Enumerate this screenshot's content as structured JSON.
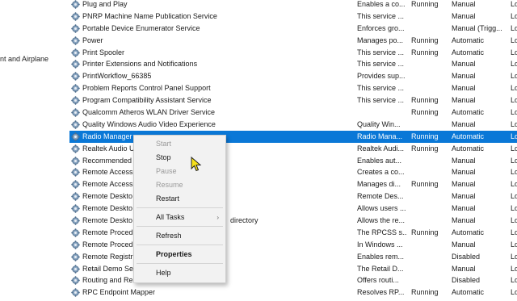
{
  "left_text": "nt and Airplane",
  "services": [
    {
      "name": "Plug and Play",
      "desc": "Enables a co...",
      "status": "Running",
      "startup": "Manual",
      "logon": "Lo"
    },
    {
      "name": "PNRP Machine Name Publication Service",
      "desc": "This service ...",
      "status": "",
      "startup": "Manual",
      "logon": "Lo"
    },
    {
      "name": "Portable Device Enumerator Service",
      "desc": "Enforces gro...",
      "status": "",
      "startup": "Manual (Trigg...",
      "logon": "Lo"
    },
    {
      "name": "Power",
      "desc": "Manages po...",
      "status": "Running",
      "startup": "Automatic",
      "logon": "Lo"
    },
    {
      "name": "Print Spooler",
      "desc": "This service ...",
      "status": "Running",
      "startup": "Automatic",
      "logon": "Lo"
    },
    {
      "name": "Printer Extensions and Notifications",
      "desc": "This service ...",
      "status": "",
      "startup": "Manual",
      "logon": "Lo"
    },
    {
      "name": "PrintWorkflow_66385",
      "desc": "Provides sup...",
      "status": "",
      "startup": "Manual",
      "logon": "Lo"
    },
    {
      "name": "Problem Reports Control Panel Support",
      "desc": "This service ...",
      "status": "",
      "startup": "Manual",
      "logon": "Lo"
    },
    {
      "name": "Program Compatibility Assistant Service",
      "desc": "This service ...",
      "status": "Running",
      "startup": "Manual",
      "logon": "Lo"
    },
    {
      "name": "Qualcomm Atheros WLAN Driver Service",
      "desc": "",
      "status": "Running",
      "startup": "Automatic",
      "logon": "Lo"
    },
    {
      "name": "Quality Windows Audio Video Experience",
      "desc": "Quality Win...",
      "status": "",
      "startup": "Manual",
      "logon": "Lo"
    },
    {
      "name": "Radio Manager Service",
      "desc": "Radio Mana...",
      "status": "Running",
      "startup": "Automatic",
      "logon": "Lo"
    },
    {
      "name": "Realtek Audio Universal Service",
      "desc": "Realtek Audi...",
      "status": "Running",
      "startup": "Automatic",
      "logon": "Lo"
    },
    {
      "name": "Recommended Troubleshooting Service",
      "desc": "Enables aut...",
      "status": "",
      "startup": "Manual",
      "logon": "Lo"
    },
    {
      "name": "Remote Access Auto Connection Manager",
      "desc": "Creates a co...",
      "status": "",
      "startup": "Manual",
      "logon": "Lo"
    },
    {
      "name": "Remote Access Connection Manager",
      "desc": "Manages di...",
      "status": "Running",
      "startup": "Manual",
      "logon": "Lo"
    },
    {
      "name": "Remote Desktop Configuration",
      "desc": "Remote Des...",
      "status": "",
      "startup": "Manual",
      "logon": "Lo"
    },
    {
      "name": "Remote Desktop Services",
      "desc": "Allows users ...",
      "status": "",
      "startup": "Manual",
      "logon": "Lo"
    },
    {
      "name": "Remote Desktop Services UserMode Port Redirector",
      "desc": "Allows the re...",
      "status": "",
      "startup": "Manual",
      "logon": "Lo"
    },
    {
      "name": "Remote Procedure Call (RPC)",
      "desc": "The RPCSS s...",
      "status": "Running",
      "startup": "Automatic",
      "logon": "Lo"
    },
    {
      "name": "Remote Procedure Call (RPC) Locator",
      "desc": "In Windows ...",
      "status": "",
      "startup": "Manual",
      "logon": "Lo"
    },
    {
      "name": "Remote Registry",
      "desc": "Enables rem...",
      "status": "",
      "startup": "Disabled",
      "logon": "Lo"
    },
    {
      "name": "Retail Demo Service",
      "desc": "The Retail D...",
      "status": "",
      "startup": "Manual",
      "logon": "Lo"
    },
    {
      "name": "Routing and Remote Access",
      "desc": "Offers routi...",
      "status": "",
      "startup": "Disabled",
      "logon": "Lo"
    },
    {
      "name": "RPC Endpoint Mapper",
      "desc": "Resolves RP...",
      "status": "Running",
      "startup": "Automatic",
      "logon": "Lo"
    }
  ],
  "visible_names": [
    "Plug and Play",
    "PNRP Machine Name Publication Service",
    "Portable Device Enumerator Service",
    "Power",
    "Print Spooler",
    "Printer Extensions and Notifications",
    "PrintWorkflow_66385",
    "Problem Reports Control Panel Support",
    "Program Compatibility Assistant Service",
    "Qualcomm Atheros WLAN Driver Service",
    "Quality Windows Audio Video Experience",
    "Radio Manager",
    "Realtek Audio U",
    "Recommended",
    "Remote Access",
    "Remote Access",
    "Remote Deskto",
    "Remote Deskto",
    "Remote Deskto",
    "Remote Procedu",
    "Remote Procedu",
    "Remote Registr",
    "Retail Demo Se",
    "Routing and Remote Access",
    "RPC Endpoint Mapper"
  ],
  "row18_suffix": "directory",
  "context_menu": {
    "start": "Start",
    "stop": "Stop",
    "pause": "Pause",
    "resume": "Resume",
    "restart": "Restart",
    "all_tasks": "All Tasks",
    "refresh": "Refresh",
    "properties": "Properties",
    "help": "Help"
  },
  "colors": {
    "selection": "#0a78d7",
    "menu_bg": "#f2f2f2"
  },
  "icons": {
    "service": "gear-icon",
    "submenu": "chevron-right-icon",
    "pointer": "mouse-pointer-icon"
  }
}
